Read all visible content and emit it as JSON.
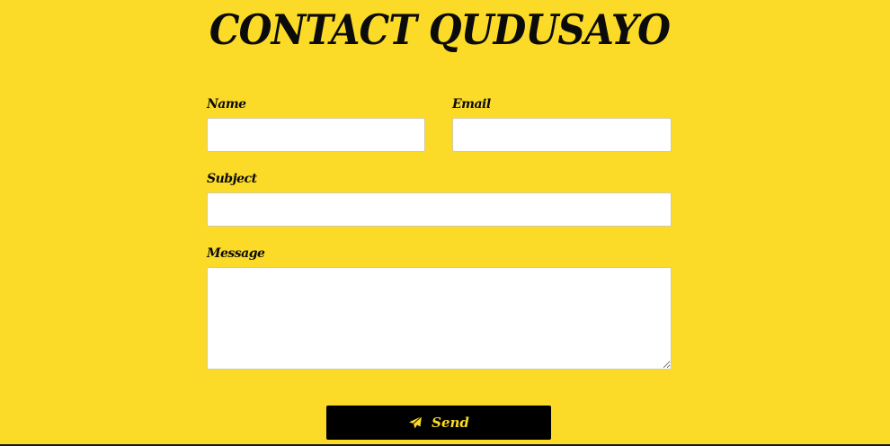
{
  "page": {
    "title": "CONTACT QUDUSAYO"
  },
  "form": {
    "name_label": "Name",
    "name_value": "",
    "email_label": "Email",
    "email_value": "",
    "subject_label": "Subject",
    "subject_value": "",
    "message_label": "Message",
    "message_value": "",
    "send_label": "Send",
    "send_icon": "paper-plane-icon"
  },
  "colors": {
    "background": "#fcdb28",
    "button": "#000000",
    "button_text": "#fcdb28",
    "text": "#0b0b0b"
  }
}
